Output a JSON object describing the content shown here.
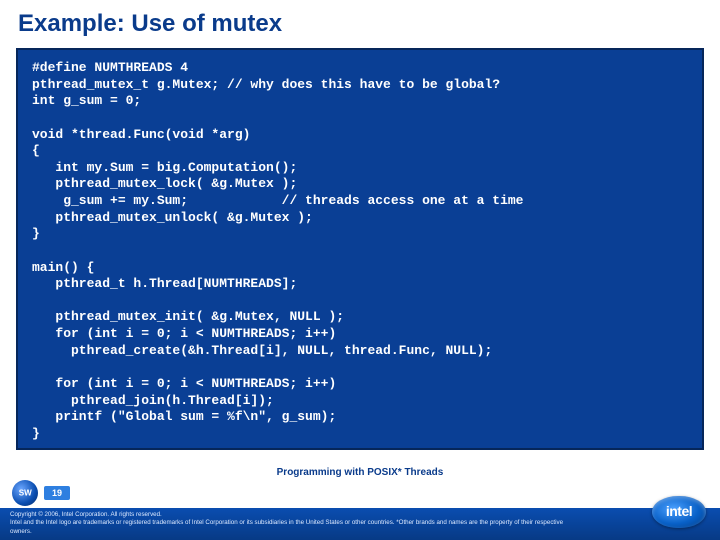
{
  "title": "Example: Use of mutex",
  "code": "#define NUMTHREADS 4\npthread_mutex_t g.Mutex; // why does this have to be global?\nint g_sum = 0;\n\nvoid *thread.Func(void *arg)\n{\n   int my.Sum = big.Computation();\n   pthread_mutex_lock( &g.Mutex );\n    g_sum += my.Sum;            // threads access one at a time\n   pthread_mutex_unlock( &g.Mutex );\n}\n\nmain() {\n   pthread_t h.Thread[NUMTHREADS];\n\n   pthread_mutex_init( &g.Mutex, NULL );\n   for (int i = 0; i < NUMTHREADS; i++)\n     pthread_create(&h.Thread[i], NULL, thread.Func, NULL);\n\n   for (int i = 0; i < NUMTHREADS; i++)\n     pthread_join(h.Thread[i]);\n   printf (\"Global sum = %f\\n\", g_sum);\n}",
  "subfooter": "Programming with POSIX* Threads",
  "page_number": "19",
  "sw_badge": "SW",
  "intel_text": "intel",
  "footer": {
    "line1": "Copyright © 2006, Intel Corporation. All rights reserved.",
    "line2": "Intel and the Intel logo are trademarks or registered trademarks of Intel Corporation or its subsidiaries in the United States or other countries. *Other brands and names are the property of their respective owners."
  }
}
